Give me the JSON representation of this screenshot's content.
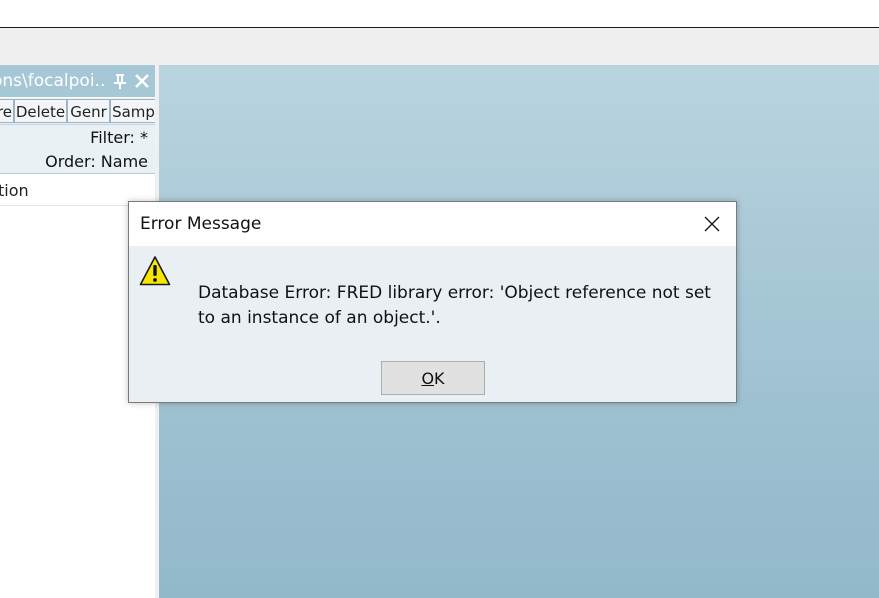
{
  "panel": {
    "title": "ons\\focalpoi...",
    "toolbar": [
      "re",
      "Delete",
      "Genr",
      "Samp"
    ],
    "filter": "Filter: *",
    "order": "Order: Name",
    "column_header": "tion"
  },
  "dialog": {
    "title": "Error Message",
    "message": "Database Error: FRED library error: 'Object reference not set to an instance of an object.'.",
    "ok_mnemonic": "O",
    "ok_rest": "K",
    "icon": "warning-icon"
  },
  "colors": {
    "panel_title_bg": "#a6c7d6",
    "workspace_top": "#b9d4df",
    "workspace_bottom": "#92b8ca",
    "dialog_bg": "#e9eff3",
    "warning_fill": "#f7e600"
  }
}
